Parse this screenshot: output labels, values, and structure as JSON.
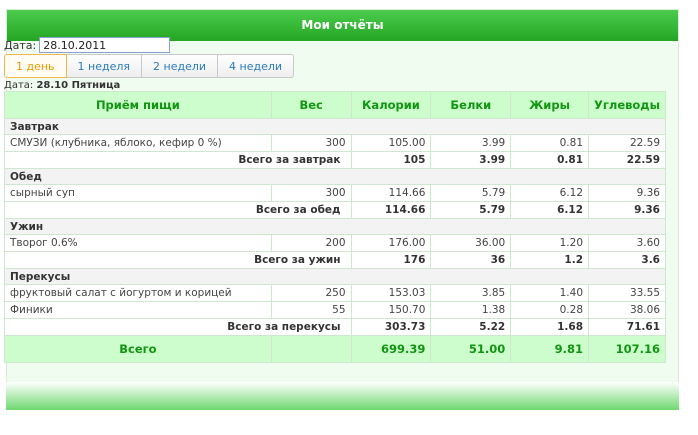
{
  "header": {
    "title": "Мои отчёты"
  },
  "date": {
    "label": "Дата:",
    "value": "28.10.2011"
  },
  "tabs": [
    {
      "label": "1 день",
      "active": true
    },
    {
      "label": "1 неделя",
      "active": false
    },
    {
      "label": "2 недели",
      "active": false
    },
    {
      "label": "4 недели",
      "active": false
    }
  ],
  "day": {
    "label": "Дата:",
    "value": "28.10 Пятница"
  },
  "table": {
    "headers": [
      "Приём пищи",
      "Вес",
      "Калории",
      "Белки",
      "Жиры",
      "Углеводы"
    ],
    "groups": [
      {
        "name": "Завтрак",
        "items": [
          [
            "СМУЗИ (клубника, яблоко, кефир 0 %)",
            "300",
            "105.00",
            "3.99",
            "0.81",
            "22.59"
          ]
        ],
        "total": [
          "Всего за завтрак",
          "105",
          "3.99",
          "0.81",
          "22.59"
        ]
      },
      {
        "name": "Обед",
        "items": [
          [
            "сырный суп",
            "300",
            "114.66",
            "5.79",
            "6.12",
            "9.36"
          ]
        ],
        "total": [
          "Всего за обед",
          "114.66",
          "5.79",
          "6.12",
          "9.36"
        ]
      },
      {
        "name": "Ужин",
        "items": [
          [
            "Творог 0.6%",
            "200",
            "176.00",
            "36.00",
            "1.20",
            "3.60"
          ]
        ],
        "total": [
          "Всего за ужин",
          "176",
          "36",
          "1.2",
          "3.6"
        ]
      },
      {
        "name": "Перекусы",
        "items": [
          [
            "фруктовый салат с йогуртом и корицей",
            "250",
            "153.03",
            "3.85",
            "1.40",
            "33.55"
          ],
          [
            "Финики",
            "55",
            "150.70",
            "1.38",
            "0.28",
            "38.06"
          ]
        ],
        "total": [
          "Всего за перекусы",
          "303.73",
          "5.22",
          "1.68",
          "71.61"
        ]
      }
    ],
    "grand": [
      "Всего",
      "699.39",
      "51.00",
      "9.81",
      "107.16"
    ]
  }
}
